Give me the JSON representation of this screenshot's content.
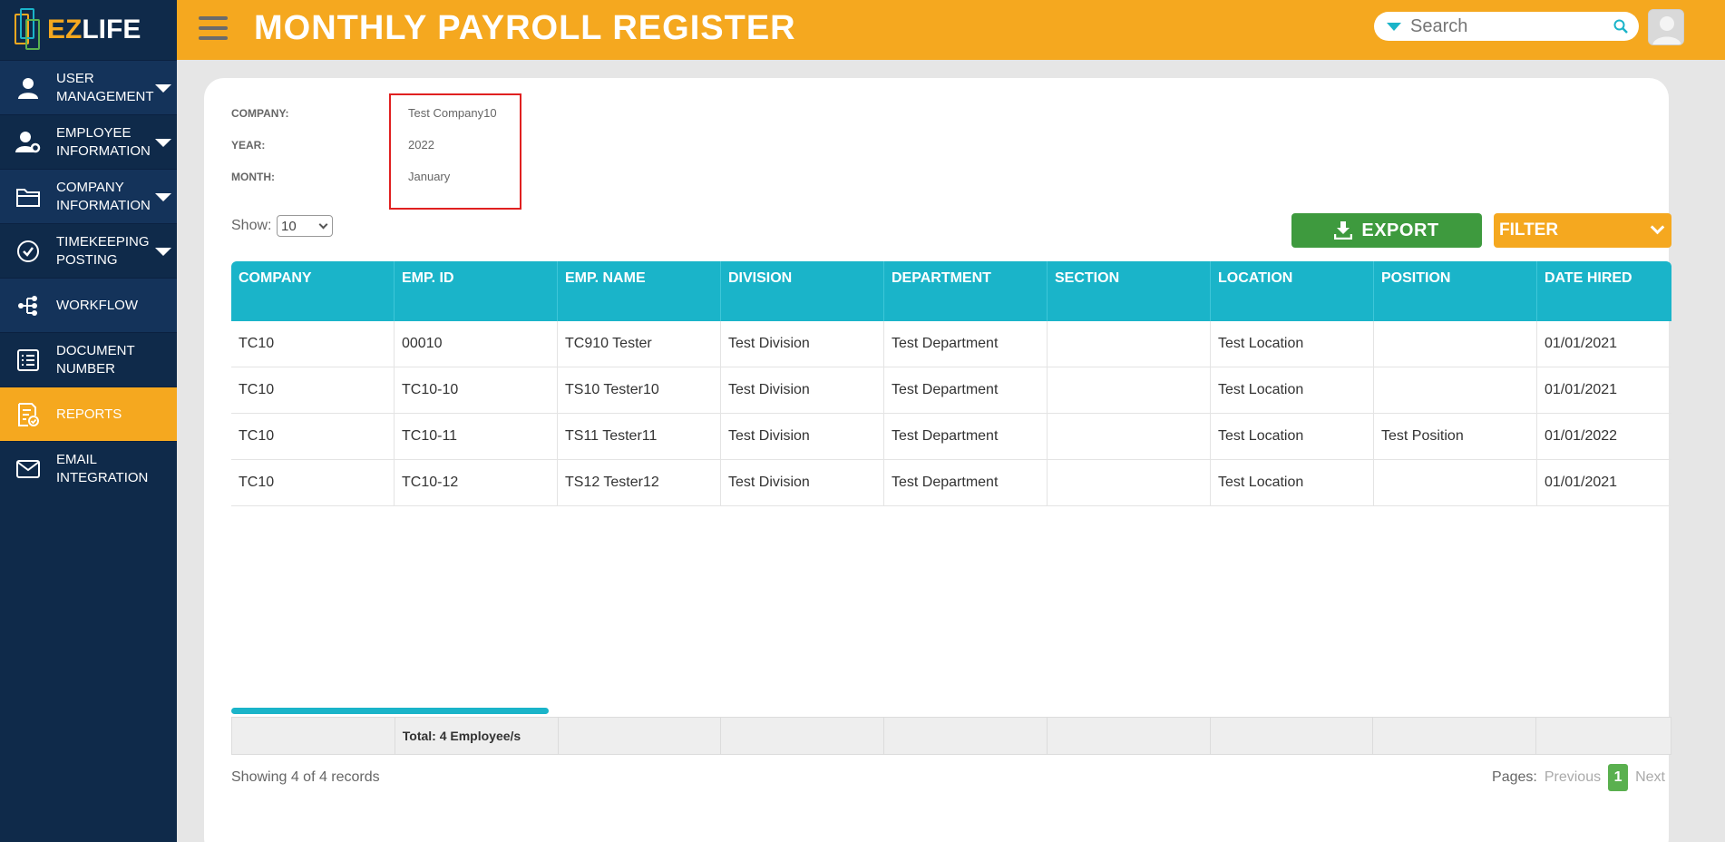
{
  "app": {
    "logo_ez": "EZ",
    "logo_life": "LIFE"
  },
  "sidebar": {
    "items": [
      {
        "label": "USER MANAGEMENT",
        "icon": "user-icon",
        "has_caret": true
      },
      {
        "label": "EMPLOYEE INFORMATION",
        "icon": "user-gear-icon",
        "has_caret": true
      },
      {
        "label": "COMPANY INFORMATION",
        "icon": "folder-icon",
        "has_caret": true
      },
      {
        "label": "TIMEKEEPING POSTING",
        "icon": "check-circle-icon",
        "has_caret": true
      },
      {
        "label": "WORKFLOW",
        "icon": "workflow-icon",
        "has_caret": false
      },
      {
        "label": "DOCUMENT NUMBER",
        "icon": "list-icon",
        "has_caret": false
      },
      {
        "label": "REPORTS",
        "icon": "report-icon",
        "has_caret": false,
        "active": true
      },
      {
        "label": "EMAIL INTEGRATION",
        "icon": "mail-icon",
        "has_caret": false
      }
    ]
  },
  "header": {
    "title": "MONTHLY PAYROLL REGISTER",
    "search_placeholder": "Search",
    "colors": {
      "header_bg": "#f5a81f",
      "sidebar_bg": "#0f2a4a",
      "accent": "#1ab4c9"
    }
  },
  "info": {
    "company_label": "COMPANY:",
    "company_value": "Test Company10",
    "year_label": "YEAR:",
    "year_value": "2022",
    "month_label": "MONTH:",
    "month_value": "January"
  },
  "controls": {
    "show_label": "Show:",
    "show_value": "10",
    "export_label": "EXPORT",
    "filter_label": "FILTER"
  },
  "table": {
    "columns": [
      "COMPANY",
      "EMP. ID",
      "EMP. NAME",
      "DIVISION",
      "DEPARTMENT",
      "SECTION",
      "LOCATION",
      "POSITION",
      "DATE HIRED"
    ],
    "rows": [
      [
        "TC10",
        "00010",
        "TC910 Tester",
        "Test Division",
        "Test Department",
        "",
        "Test Location",
        "",
        "01/01/2021"
      ],
      [
        "TC10",
        "TC10-10",
        "TS10 Tester10",
        "Test Division",
        "Test Department",
        "",
        "Test Location",
        "",
        "01/01/2021"
      ],
      [
        "TC10",
        "TC10-11",
        "TS11 Tester11",
        "Test Division",
        "Test Department",
        "",
        "Test Location",
        "Test Position",
        "01/01/2022"
      ],
      [
        "TC10",
        "TC10-12",
        "TS12 Tester12",
        "Test Division",
        "Test Department",
        "",
        "Test Location",
        "",
        "01/01/2021"
      ]
    ],
    "footer_total": "Total: 4 Employee/s"
  },
  "pagination": {
    "showing": "Showing 4 of 4 records",
    "pages_label": "Pages:",
    "previous": "Previous",
    "current": "1",
    "next": "Next"
  }
}
